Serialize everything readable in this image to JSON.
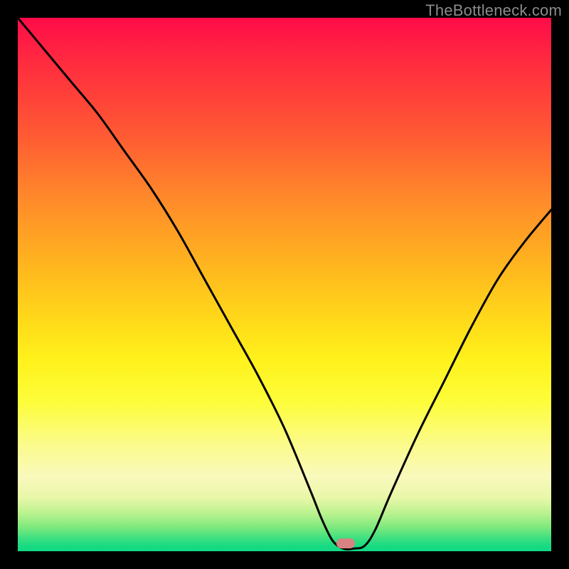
{
  "watermark": "TheBottleneck.com",
  "marker": {
    "x_frac": 0.615,
    "y_frac": 0.985,
    "color": "#d88381"
  },
  "chart_data": {
    "type": "line",
    "title": "",
    "xlabel": "",
    "ylabel": "",
    "xlim": [
      0,
      100
    ],
    "ylim": [
      0,
      100
    ],
    "grid": false,
    "legend": false,
    "background": "vertical rainbow gradient red(top) to green(bottom)",
    "series": [
      {
        "name": "bottleneck-curve",
        "x": [
          0,
          5,
          10,
          15,
          20,
          25,
          30,
          35,
          40,
          45,
          50,
          55,
          57,
          59,
          61,
          63,
          65,
          67,
          70,
          75,
          80,
          85,
          90,
          95,
          100
        ],
        "y": [
          100,
          94,
          88,
          82,
          75,
          68,
          60,
          51,
          42,
          33,
          23,
          11,
          6,
          2,
          0.5,
          0.5,
          1,
          4,
          11,
          22,
          32,
          42,
          51,
          58,
          64
        ]
      }
    ],
    "annotations": [
      {
        "type": "marker",
        "shape": "rounded-rect",
        "x": 61.5,
        "y": 1.5,
        "color": "#d88381"
      }
    ]
  }
}
